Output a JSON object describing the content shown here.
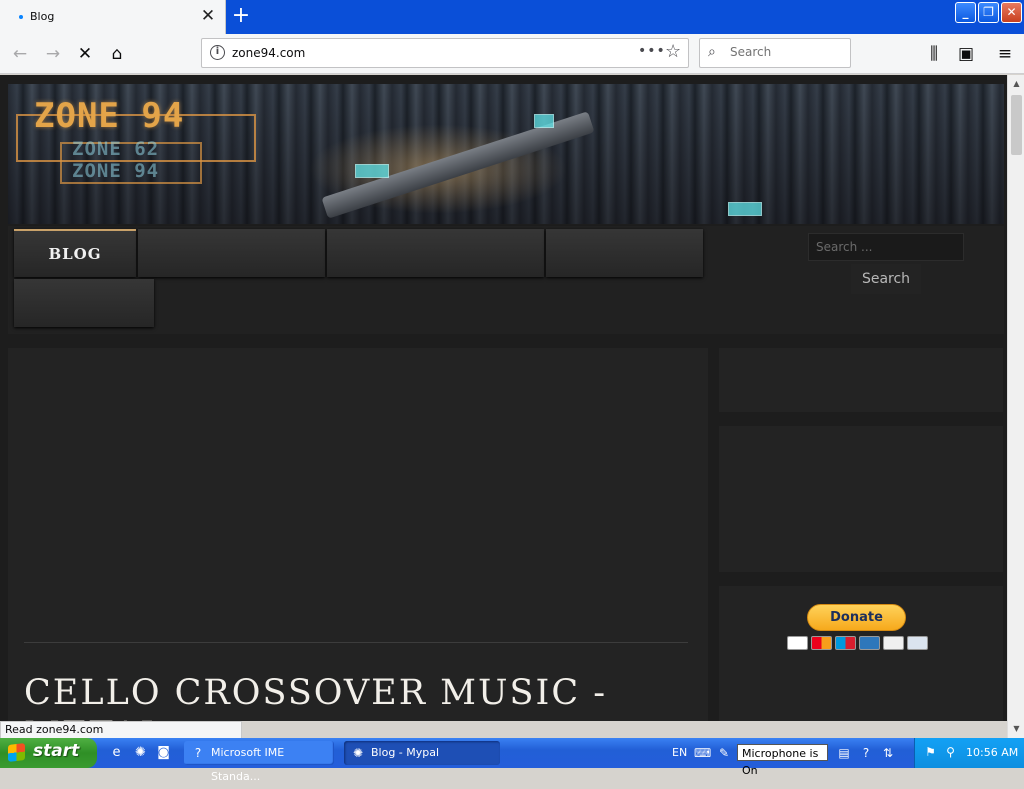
{
  "browser": {
    "tab_title": "Blog",
    "tab_close": "✕",
    "new_tab": "+",
    "window_minimize": "_",
    "window_restore": "❐",
    "window_close": "✕",
    "url": "zone94.com",
    "page_actions": "•••",
    "search_placeholder": "Search",
    "status_text": "Read zone94.com"
  },
  "site": {
    "logo_main": "ZONE 94",
    "logo_sub_1": "ZONE 62",
    "logo_sub_2": "ZONE 94",
    "menu": [
      {
        "label": "BLOG",
        "active": true
      },
      {
        "label": ""
      },
      {
        "label": ""
      },
      {
        "label": ""
      },
      {
        "label": ""
      }
    ],
    "search_placeholder": "Search ...",
    "search_button": "Search",
    "post_title": "CELLO CROSSOVER MUSIC - METAL",
    "donate_label": "Donate",
    "payment_cards": [
      "visa",
      "mastercard",
      "maestro",
      "amex",
      "discover",
      "bank"
    ]
  },
  "taskbar": {
    "start_label": "start",
    "tasks": [
      {
        "label": "Microsoft IME Standa...",
        "active": false
      },
      {
        "label": "Blog - Mypal",
        "active": true
      }
    ],
    "language": "EN",
    "mic_status": "Microphone is On",
    "clock": "10:56 AM"
  },
  "colors": {
    "taskbar_blue": "#245edb",
    "start_green": "#3a9b30",
    "site_bg": "#1d1d1d",
    "menu_accent": "#c9a26a",
    "logo_orange": "#e3a449",
    "donate_yellow": "#f6a91c"
  }
}
